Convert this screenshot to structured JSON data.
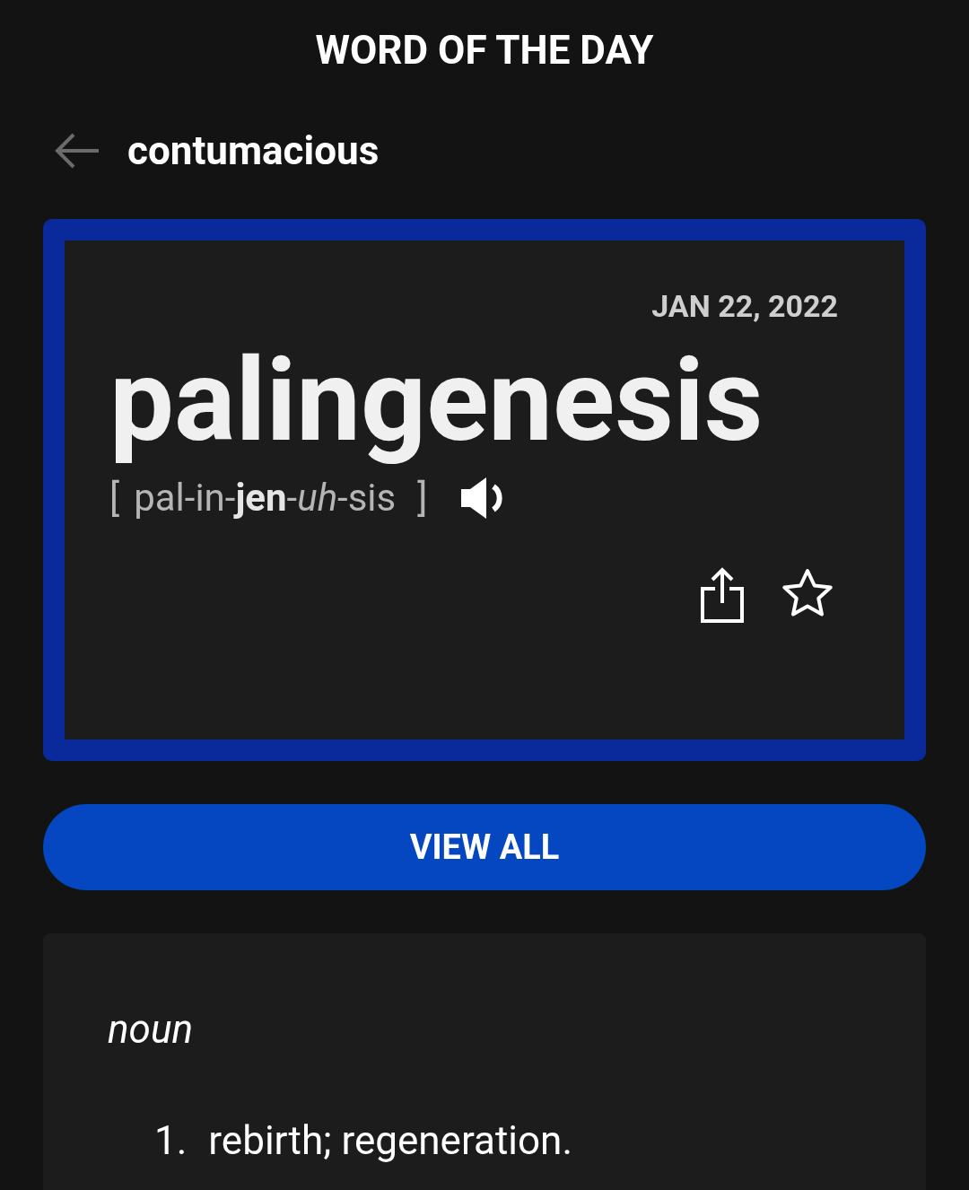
{
  "title": "WORD OF THE DAY",
  "header": {
    "word": "contumacious"
  },
  "card": {
    "date": "JAN 22, 2022",
    "word": "palingenesis",
    "open_bracket": "[",
    "pronunciation": "pal-in-**jen**-*uh*-sis",
    "close_bracket": "]"
  },
  "button": "VIEW ALL",
  "definition": {
    "part_of_speech": "noun",
    "senses": [
      {
        "number": "1.",
        "text": "rebirth; regeneration."
      }
    ]
  }
}
